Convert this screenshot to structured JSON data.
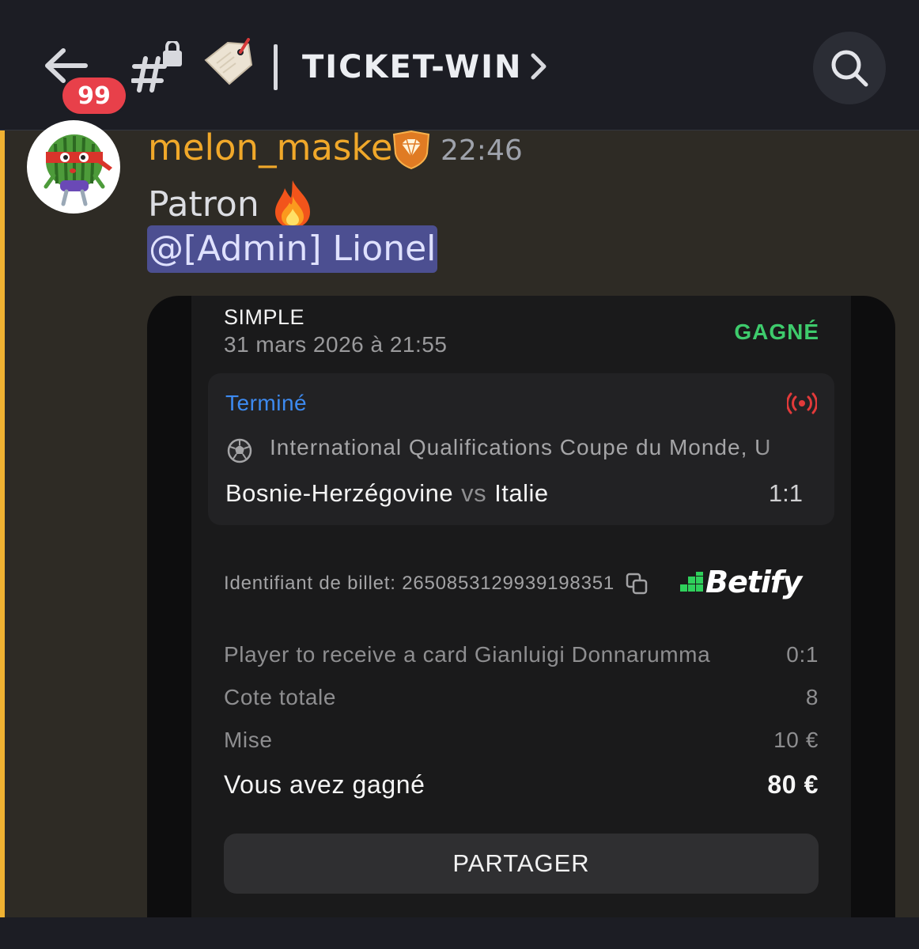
{
  "header": {
    "unread_count": "99",
    "channel_name": "TICKET-WIN"
  },
  "colors": {
    "accent_highlight": "#f0b232",
    "username": "#f0a82a",
    "mention_bg": "#4c4f91",
    "win_green": "#3ecb6c",
    "status_blue": "#3d8af0",
    "badge_red": "#e8404a"
  },
  "message": {
    "author": "melon_maske",
    "time": "22:46",
    "text": "Patron",
    "mention": "@[Admin] Lionel"
  },
  "ticket": {
    "bet_type": "SIMPLE",
    "date": "31 mars 2026 à 21:55",
    "result": "GAGNÉ",
    "match": {
      "state": "Terminé",
      "league": "International Qualifications Coupe du Monde, U",
      "home": "Bosnie-Herzégovine",
      "vs": "vs",
      "away": "Italie",
      "score": "1:1"
    },
    "ticket_id_label": "Identifiant de billet: 2650853129939198351",
    "brand": "Betify",
    "selection": {
      "label": "Player to receive a card Gianluigi Donnarumma",
      "value": "0:1"
    },
    "odds": {
      "label": "Cote totale",
      "value": "8"
    },
    "stake": {
      "label": "Mise",
      "value": "10 €"
    },
    "winnings": {
      "label": "Vous avez gagné",
      "value": "80 €"
    },
    "share_label": "PARTAGER"
  }
}
